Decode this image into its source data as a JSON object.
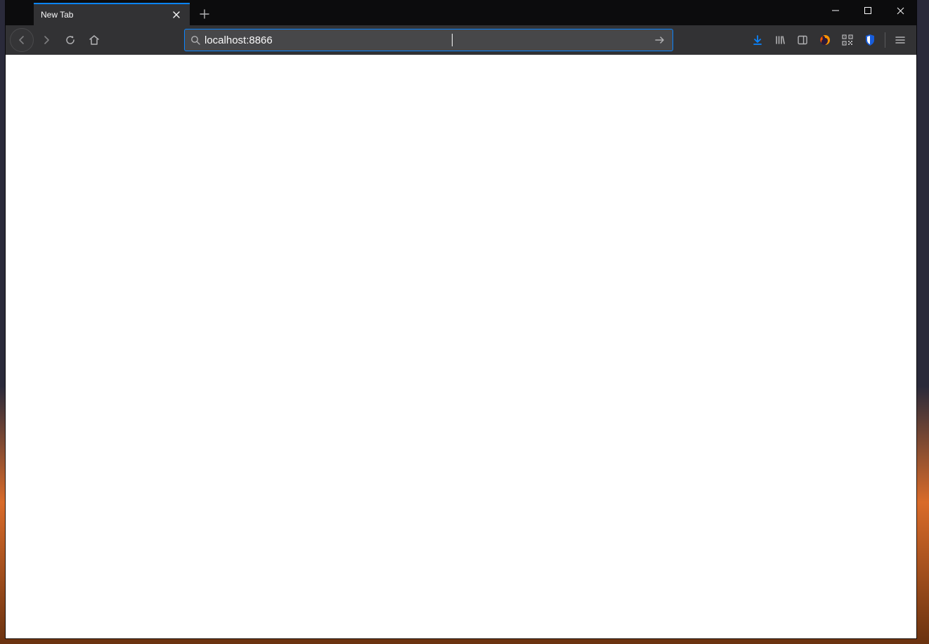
{
  "tab": {
    "title": "New Tab"
  },
  "addressbar": {
    "value": "localhost:8866"
  },
  "colors": {
    "accent": "#0a84ff",
    "download": "#0a84ff"
  },
  "icons": {
    "back": "back-icon",
    "forward": "forward-icon",
    "reload": "reload-icon",
    "home": "home-icon",
    "search": "search-icon",
    "go": "go-arrow-icon",
    "newtab": "plus-icon",
    "close": "close-icon",
    "minimize": "window-minimize-icon",
    "maximize": "window-maximize-icon",
    "closewin": "window-close-icon",
    "downloads": "downloads-icon",
    "library": "library-icon",
    "sidebar": "sidebar-icon",
    "firefox": "firefox-logo-icon",
    "qr": "qr-code-icon",
    "bitwarden": "shield-icon",
    "menu": "hamburger-icon"
  }
}
